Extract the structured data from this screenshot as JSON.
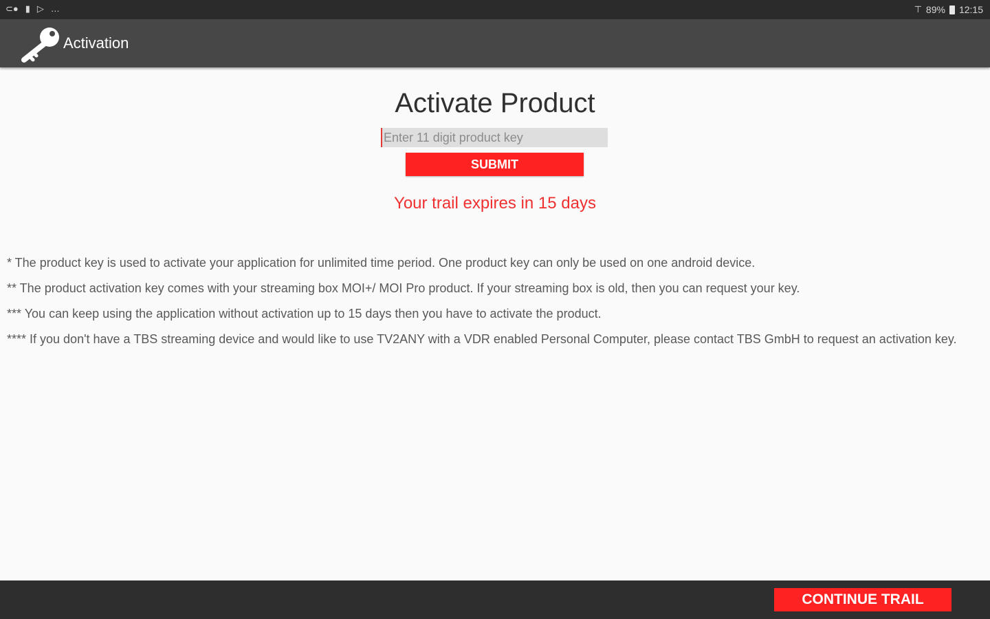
{
  "status_bar": {
    "left_icons": [
      "cast-icon",
      "usb-icon",
      "play-store-icon"
    ],
    "more": "…",
    "signal_icon": "wifi-icon",
    "battery": "89%",
    "time": "12:15"
  },
  "app_bar": {
    "icon": "key-icon",
    "title": "Activation"
  },
  "main": {
    "title": "Activate Product",
    "input": {
      "placeholder": "Enter 11 digit product key",
      "value": ""
    },
    "submit_label": "SUBMIT",
    "trial_message": "Your trail expires in 15 days"
  },
  "notes": [
    "* The product key is used to activate your application for unlimited time period. One product key can only be used on one android device.",
    "** The product activation key comes with your streaming box MOI+/ MOI Pro product. If your streaming box is old, then you can request your key.",
    "*** You can keep using the application without activation up to 15 days then you have to activate the product.",
    "**** If you don't have a TBS streaming device and would like to use TV2ANY with a VDR enabled Personal Computer, please contact TBS GmbH to request an activation key."
  ],
  "bottom_bar": {
    "continue_label": "CONTINUE TRAIL"
  },
  "colors": {
    "accent_red": "#ff2222",
    "app_bar": "#474747",
    "status_bar": "#2b2b2b",
    "bottom_bar": "#2e2e2e"
  }
}
